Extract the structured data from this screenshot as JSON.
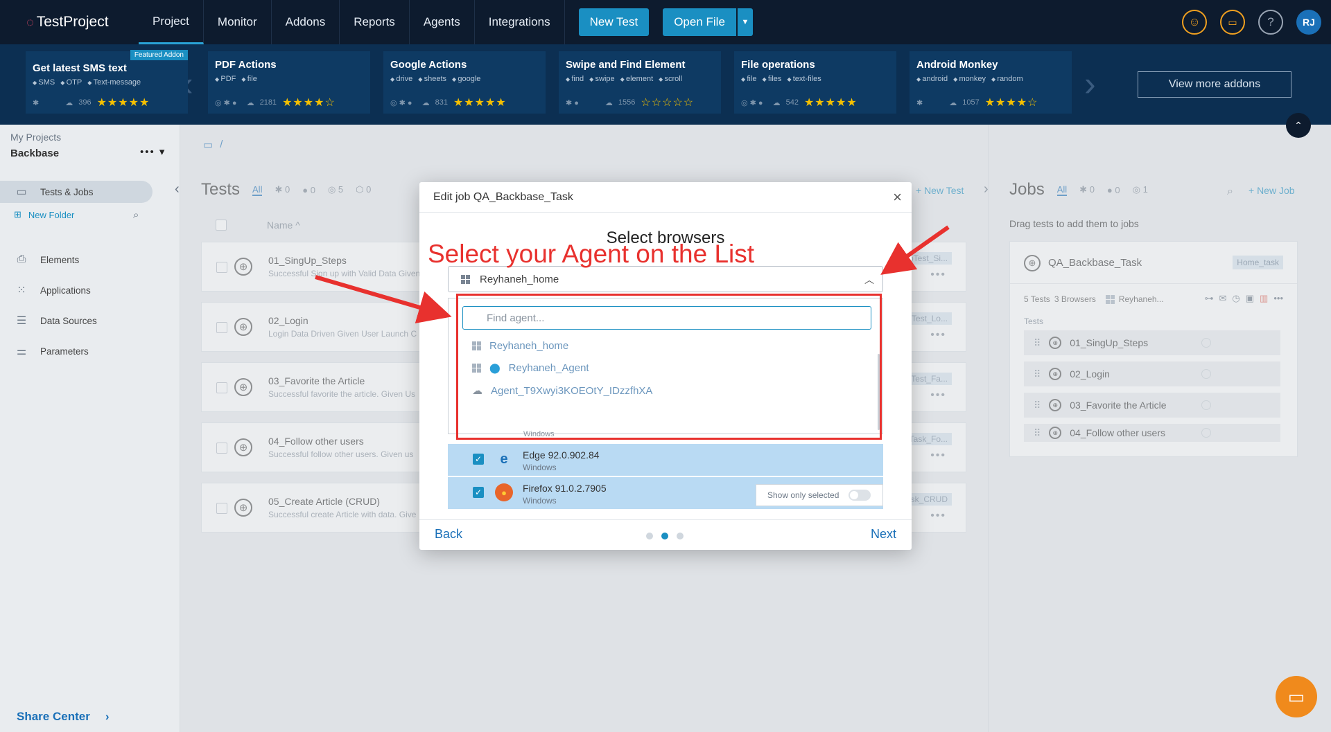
{
  "app": {
    "logo": "TestProject"
  },
  "nav": {
    "tabs": [
      "Project",
      "Monitor",
      "Addons",
      "Reports",
      "Agents",
      "Integrations"
    ],
    "new_test": "New Test",
    "open_file": "Open File",
    "avatar": "RJ"
  },
  "addons": {
    "featured_label": "Featured Addon",
    "view_more": "View more addons",
    "cards": [
      {
        "title": "Get latest SMS text",
        "tags": [
          "SMS",
          "OTP",
          "Text-message"
        ],
        "count": "396",
        "stars": "★★★★★"
      },
      {
        "title": "PDF Actions",
        "tags": [
          "PDF",
          "file"
        ],
        "count": "2181",
        "stars": "★★★★☆"
      },
      {
        "title": "Google Actions",
        "tags": [
          "drive",
          "sheets",
          "google"
        ],
        "count": "831",
        "stars": "★★★★★"
      },
      {
        "title": "Swipe and Find Element",
        "tags": [
          "find",
          "swipe",
          "element",
          "scroll"
        ],
        "count": "1556",
        "stars": "☆☆☆☆☆"
      },
      {
        "title": "File operations",
        "tags": [
          "file",
          "files",
          "text-files"
        ],
        "count": "542",
        "stars": "★★★★★"
      },
      {
        "title": "Android Monkey",
        "tags": [
          "android",
          "monkey",
          "random"
        ],
        "count": "1057",
        "stars": "★★★★☆"
      }
    ]
  },
  "sidebar": {
    "my_projects": "My Projects",
    "project": "Backbase",
    "items": [
      "Tests & Jobs",
      "Elements",
      "Applications",
      "Data Sources",
      "Parameters"
    ],
    "new_folder": "New Folder",
    "share_center": "Share Center"
  },
  "breadcrumb": "/",
  "tests": {
    "title": "Tests",
    "filters": {
      "all": "All",
      "android": "0",
      "ios": "0",
      "web": "5",
      "generic": "0"
    },
    "new_test": "+ New Test",
    "col_name": "Name ^",
    "rows": [
      {
        "name": "01_SingUp_Steps",
        "desc": "Successful Sign up with Valid Data Given",
        "tag": "bTest_Si..."
      },
      {
        "name": "02_Login",
        "desc": "Login Data Driven Given User Launch C",
        "tag": "bTest_Lo..."
      },
      {
        "name": "03_Favorite the Article",
        "desc": "Successful favorite the article. Given Us",
        "tag": "bTest_Fa..."
      },
      {
        "name": "04_Follow other users",
        "desc": "Successful follow other users. Given us",
        "tag": "bTask_Fo..."
      },
      {
        "name": "05_Create Article (CRUD)",
        "desc": "Successful create Article with data. Give",
        "tag": "Task_CRUD"
      }
    ]
  },
  "jobs": {
    "title": "Jobs",
    "filters": {
      "all": "All",
      "android": "0",
      "ios": "0",
      "web": "1"
    },
    "new_job": "+ New Job",
    "hint": "Drag tests to add them to jobs",
    "card": {
      "name": "QA_Backbase_Task",
      "tag": "Home_task",
      "tests_count": "5 Tests",
      "browsers": "3 Browsers",
      "agent": "Reyhaneh...",
      "tests_label": "Tests",
      "tests": [
        "01_SingUp_Steps",
        "02_Login",
        "03_Favorite the Article",
        "04_Follow other users"
      ]
    }
  },
  "modal": {
    "header": "Edit job QA_Backbase_Task",
    "title": "Select browsers",
    "selected_agent": "Reyhaneh_home",
    "search_placeholder": "Find agent...",
    "agents": [
      "Reyhaneh_home",
      "Reyhaneh_Agent",
      "Agent_T9Xwyi3KOEOtY_IDzzfhXA"
    ],
    "hidden_os": "Windows",
    "browsers": [
      {
        "name": "Edge 92.0.902.84",
        "os": "Windows"
      },
      {
        "name": "Firefox 91.0.2.7905",
        "os": "Windows"
      }
    ],
    "show_only_selected": "Show only selected",
    "back": "Back",
    "next": "Next"
  },
  "annotation": {
    "text": "Select your Agent on the List",
    "color": "#e8312e"
  }
}
